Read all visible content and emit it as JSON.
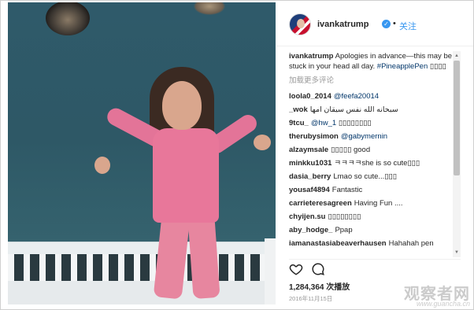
{
  "post": {
    "username": "ivankatrump",
    "verified_glyph": "✓",
    "separator": "•",
    "follow_label": "关注"
  },
  "caption": {
    "user": "ivankatrump",
    "text": "Apologies in advance—this may be stuck in your head all day.",
    "hashtag": "#PineapplePen",
    "trailing": "▯▯▯▯"
  },
  "load_more_label": "加载更多评论",
  "comments": [
    {
      "user": "loola0_2014",
      "mention": "@feefa20014",
      "text": ""
    },
    {
      "user": "_wok",
      "mention": "",
      "text": "سبحانه الله نفس سيقان امها"
    },
    {
      "user": "9tcu_",
      "mention": "@hw_1",
      "text": "▯▯▯▯▯▯▯▯"
    },
    {
      "user": "therubysimon",
      "mention": "@gabymernin",
      "text": ""
    },
    {
      "user": "alzaymsale",
      "mention": "",
      "text": "▯▯▯▯▯ good"
    },
    {
      "user": "minkku1031",
      "mention": "",
      "text": "ㅋㅋㅋㅋshe is so cute▯▯▯"
    },
    {
      "user": "dasia_berry",
      "mention": "",
      "text": "Lmao so cute...▯▯▯"
    },
    {
      "user": "yousaf4894",
      "mention": "",
      "text": "Fantastic"
    },
    {
      "user": "carrieteresagreen",
      "mention": "",
      "text": "Having Fun ...."
    },
    {
      "user": "chyijen.su",
      "mention": "",
      "text": "▯▯▯▯▯▯▯▯"
    },
    {
      "user": "aby_hodge_",
      "mention": "",
      "text": "Ppap"
    },
    {
      "user": "iamanastasiabeaverhausen",
      "mention": "",
      "text": "Hahahah pen"
    }
  ],
  "scrollbar": {
    "up": "▲",
    "down": "▼"
  },
  "stats": {
    "views": "1,284,364 次播放",
    "date": "2016年11月15日"
  },
  "watermark": {
    "main": "观察者网",
    "sub": "www.guancha.cn"
  },
  "colors": {
    "accent": "#3897f0",
    "hashtag": "#003569"
  },
  "icons": [
    "heart-icon",
    "comment-icon",
    "verified-icon"
  ]
}
